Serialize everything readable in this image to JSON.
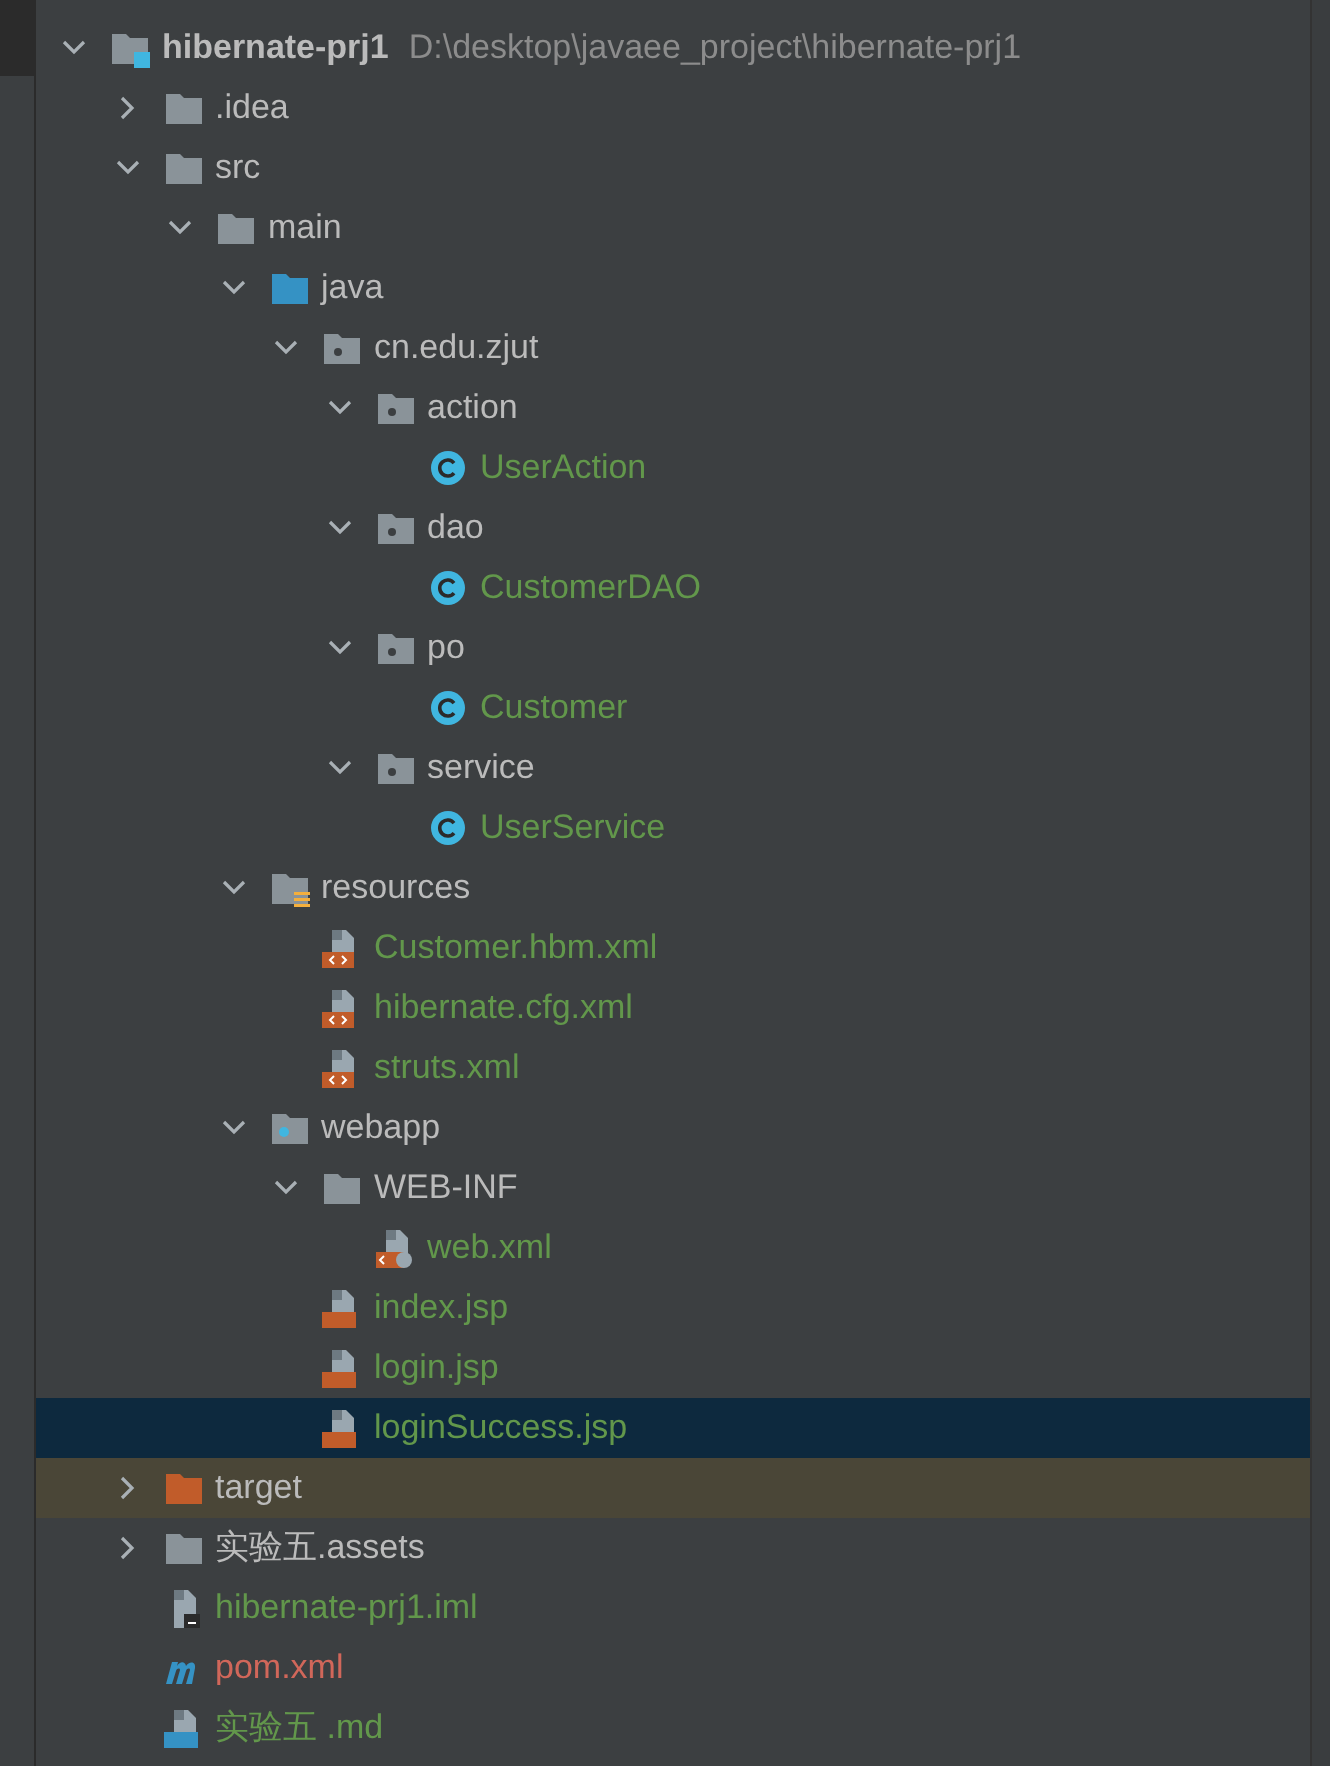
{
  "tree": [
    {
      "kind": "module",
      "name": "hibernate-prj1",
      "path": "D:\\desktop\\javaee_project\\hibernate-prj1",
      "color": "#bbbbbb",
      "selected": false,
      "expanded": true,
      "children": [
        {
          "kind": "folder",
          "name": ".idea",
          "color": "#bbbbbb",
          "selected": false,
          "expanded": false
        },
        {
          "kind": "folder",
          "name": "src",
          "color": "#bbbbbb",
          "selected": false,
          "expanded": true,
          "children": [
            {
              "kind": "folder",
              "name": "main",
              "color": "#bbbbbb",
              "selected": false,
              "expanded": true,
              "children": [
                {
                  "kind": "source",
                  "name": "java",
                  "color": "#bbbbbb",
                  "selected": false,
                  "expanded": true,
                  "children": [
                    {
                      "kind": "package",
                      "name": "cn.edu.zjut",
                      "color": "#bbbbbb",
                      "selected": false,
                      "expanded": true,
                      "children": [
                        {
                          "kind": "package",
                          "name": "action",
                          "color": "#bbbbbb",
                          "selected": false,
                          "expanded": true,
                          "children": [
                            {
                              "kind": "class",
                              "name": "UserAction",
                              "color": "#62974b",
                              "selected": false
                            }
                          ]
                        },
                        {
                          "kind": "package",
                          "name": "dao",
                          "color": "#bbbbbb",
                          "selected": false,
                          "expanded": true,
                          "children": [
                            {
                              "kind": "class",
                              "name": "CustomerDAO",
                              "color": "#62974b",
                              "selected": false
                            }
                          ]
                        },
                        {
                          "kind": "package",
                          "name": "po",
                          "color": "#bbbbbb",
                          "selected": false,
                          "expanded": true,
                          "children": [
                            {
                              "kind": "class",
                              "name": "Customer",
                              "color": "#62974b",
                              "selected": false
                            }
                          ]
                        },
                        {
                          "kind": "package",
                          "name": "service",
                          "color": "#bbbbbb",
                          "selected": false,
                          "expanded": true,
                          "children": [
                            {
                              "kind": "class",
                              "name": "UserService",
                              "color": "#62974b",
                              "selected": false
                            }
                          ]
                        }
                      ]
                    }
                  ]
                },
                {
                  "kind": "resources",
                  "name": "resources",
                  "color": "#bbbbbb",
                  "selected": false,
                  "expanded": true,
                  "children": [
                    {
                      "kind": "xml",
                      "name": "Customer.hbm.xml",
                      "color": "#62974b",
                      "selected": false
                    },
                    {
                      "kind": "xml",
                      "name": "hibernate.cfg.xml",
                      "color": "#62974b",
                      "selected": false
                    },
                    {
                      "kind": "xml",
                      "name": "struts.xml",
                      "color": "#62974b",
                      "selected": false
                    }
                  ]
                },
                {
                  "kind": "web",
                  "name": "webapp",
                  "color": "#bbbbbb",
                  "selected": false,
                  "expanded": true,
                  "children": [
                    {
                      "kind": "folder",
                      "name": "WEB-INF",
                      "color": "#bbbbbb",
                      "selected": false,
                      "expanded": true,
                      "children": [
                        {
                          "kind": "webxml",
                          "name": "web.xml",
                          "color": "#62974b",
                          "selected": false
                        }
                      ]
                    },
                    {
                      "kind": "jsp",
                      "name": "index.jsp",
                      "color": "#62974b",
                      "selected": false
                    },
                    {
                      "kind": "jsp",
                      "name": "login.jsp",
                      "color": "#62974b",
                      "selected": false
                    },
                    {
                      "kind": "jsp",
                      "name": "loginSuccess.jsp",
                      "color": "#62974b",
                      "selected": true
                    }
                  ]
                }
              ]
            }
          ]
        },
        {
          "kind": "excluded",
          "name": "target",
          "color": "#bbbbbb",
          "selected": false,
          "expanded": false
        },
        {
          "kind": "folder",
          "name": "实验五.assets",
          "color": "#bbbbbb",
          "selected": false,
          "expanded": false
        },
        {
          "kind": "iml",
          "name": "hibernate-prj1.iml",
          "color": "#62974b",
          "selected": false
        },
        {
          "kind": "maven",
          "name": "pom.xml",
          "color": "#d1675a",
          "selected": false
        },
        {
          "kind": "md",
          "name": "实验五 .md",
          "color": "#62974b",
          "selected": false
        }
      ]
    }
  ]
}
